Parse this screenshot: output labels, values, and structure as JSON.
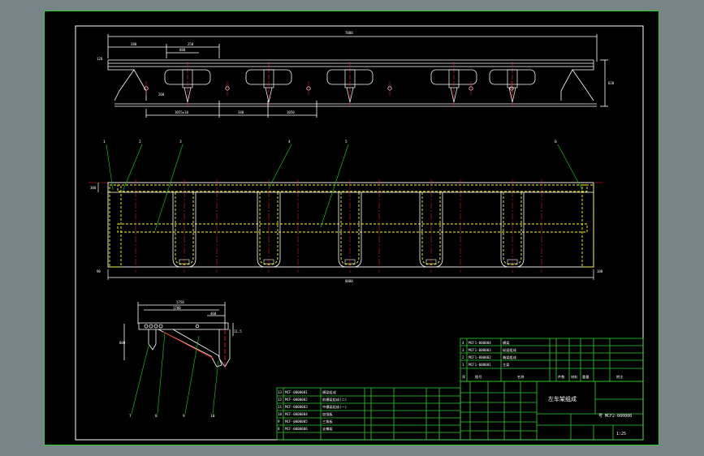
{
  "drawing": {
    "title_cn": "左车架组成",
    "drawing_no": "号 MCF2-000000",
    "scale": "1:25"
  },
  "colors": {
    "background": "#798486",
    "sheet": "#000000",
    "border": "#2fd12f",
    "outline": "#ffffff",
    "hidden_line": "#ffff00",
    "center_line": "#ff2020",
    "leader": "#00e000",
    "dim": "#ffffff"
  },
  "views": {
    "top_dims": {
      "overall": "7080",
      "d1": "280",
      "d2": "250",
      "d3": "880",
      "d4": "200",
      "height": "620",
      "d5": "1055±10",
      "d6": "340",
      "d7": "1050",
      "left_small": "120"
    },
    "mid_dims": {
      "overall": "8080",
      "left": "380",
      "bottom_left": "90",
      "bottom_right": "100"
    },
    "mid_balloons": [
      "1",
      "2",
      "3",
      "4",
      "5",
      "6"
    ],
    "side_dims": {
      "top": "1750",
      "inner": "1700",
      "small": "460",
      "left": "800",
      "right": "11.5"
    },
    "side_balloons": [
      "7",
      "8",
      "9",
      "10"
    ]
  },
  "parts_list": {
    "rows": [
      {
        "no": "13",
        "code": "MCF-0000001",
        "name": "横梁组成"
      },
      {
        "no": "12",
        "code": "MCF-0000002",
        "name": "前横梁组成(二)"
      },
      {
        "no": "11",
        "code": "MCF-0000003",
        "name": "中横梁组成(一)"
      },
      {
        "no": "10",
        "code": "MCF-0000004",
        "name": "加强板"
      },
      {
        "no": "9",
        "code": "MCF-0000005",
        "name": "三角板"
      },
      {
        "no": "8",
        "code": "MCF-0000006",
        "name": "支撑架"
      }
    ],
    "upper_rows": [
      {
        "no": "4",
        "code": "MCF1-000004",
        "name": "横梁"
      },
      {
        "no": "3",
        "code": "MCF1-000003",
        "name": "纵梁组成"
      },
      {
        "no": "2",
        "code": "MCF1-000002",
        "name": "端梁组成"
      },
      {
        "no": "1",
        "code": "MCF1-000001",
        "name": "主梁"
      }
    ],
    "header": {
      "no": "序",
      "code": "图号",
      "name": "名称",
      "qty": "件数",
      "mat": "材料",
      "mass": "重量",
      "note": "附注"
    }
  }
}
